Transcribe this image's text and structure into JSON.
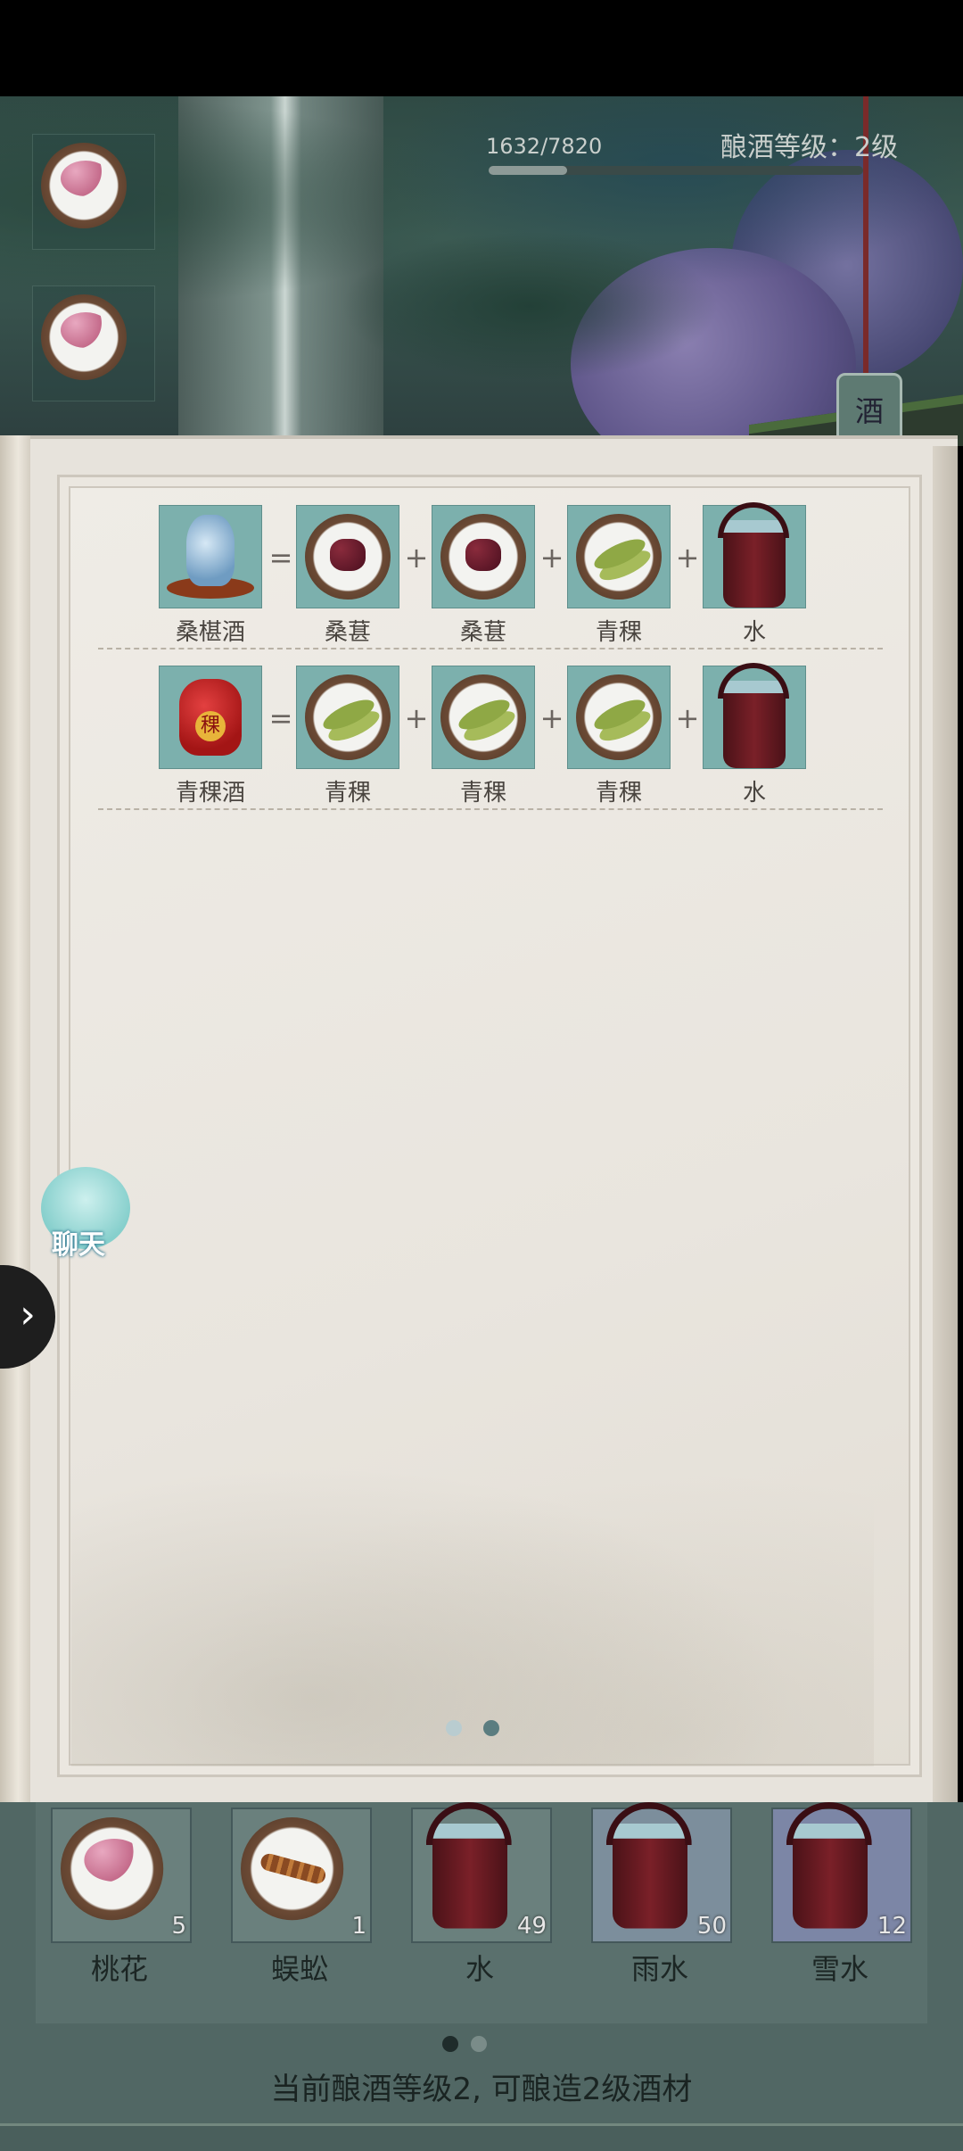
{
  "header": {
    "progress_text": "1632/7820",
    "progress_fraction": 0.2087,
    "level_label": "酿酒等级：2级",
    "side_tab": "酒"
  },
  "side_slots": [
    {
      "icon": "peach-blossom-icon"
    },
    {
      "icon": "peach-blossom-icon"
    }
  ],
  "recipes": [
    {
      "result": {
        "label": "桑椹酒",
        "icon": "mulberry-wine-icon"
      },
      "ingredients": [
        {
          "label": "桑葚",
          "icon": "mulberry-icon"
        },
        {
          "label": "桑葚",
          "icon": "mulberry-icon"
        },
        {
          "label": "青稞",
          "icon": "barley-icon"
        },
        {
          "label": "水",
          "icon": "water-bucket-icon"
        }
      ]
    },
    {
      "result": {
        "label": "青稞酒",
        "icon": "barley-wine-jar-icon"
      },
      "ingredients": [
        {
          "label": "青稞",
          "icon": "barley-icon"
        },
        {
          "label": "青稞",
          "icon": "barley-icon"
        },
        {
          "label": "青稞",
          "icon": "barley-icon"
        },
        {
          "label": "水",
          "icon": "water-bucket-icon"
        }
      ]
    }
  ],
  "operators": {
    "equals": "=",
    "plus": "+"
  },
  "book_pages": {
    "count": 2,
    "current": 2
  },
  "chat": {
    "label": "聊天"
  },
  "expand_handle": {
    "glyph": "›"
  },
  "inventory": {
    "items": [
      {
        "label": "桃花",
        "count": "5",
        "icon": "peach-blossom-icon"
      },
      {
        "label": "蜈蚣",
        "count": "1",
        "icon": "centipede-icon"
      },
      {
        "label": "水",
        "count": "49",
        "icon": "water-bucket-icon"
      },
      {
        "label": "雨水",
        "count": "50",
        "icon": "rainwater-bucket-icon"
      },
      {
        "label": "雪水",
        "count": "12",
        "icon": "snowwater-bucket-icon"
      }
    ],
    "pages": {
      "count": 2,
      "current": 1
    },
    "caption": "当前酿酒等级2, 可酿造2级酒材"
  },
  "colors": {
    "tile": "#7cb0ad",
    "book": "#e7e3dc",
    "inventory_bg": "#516764"
  }
}
